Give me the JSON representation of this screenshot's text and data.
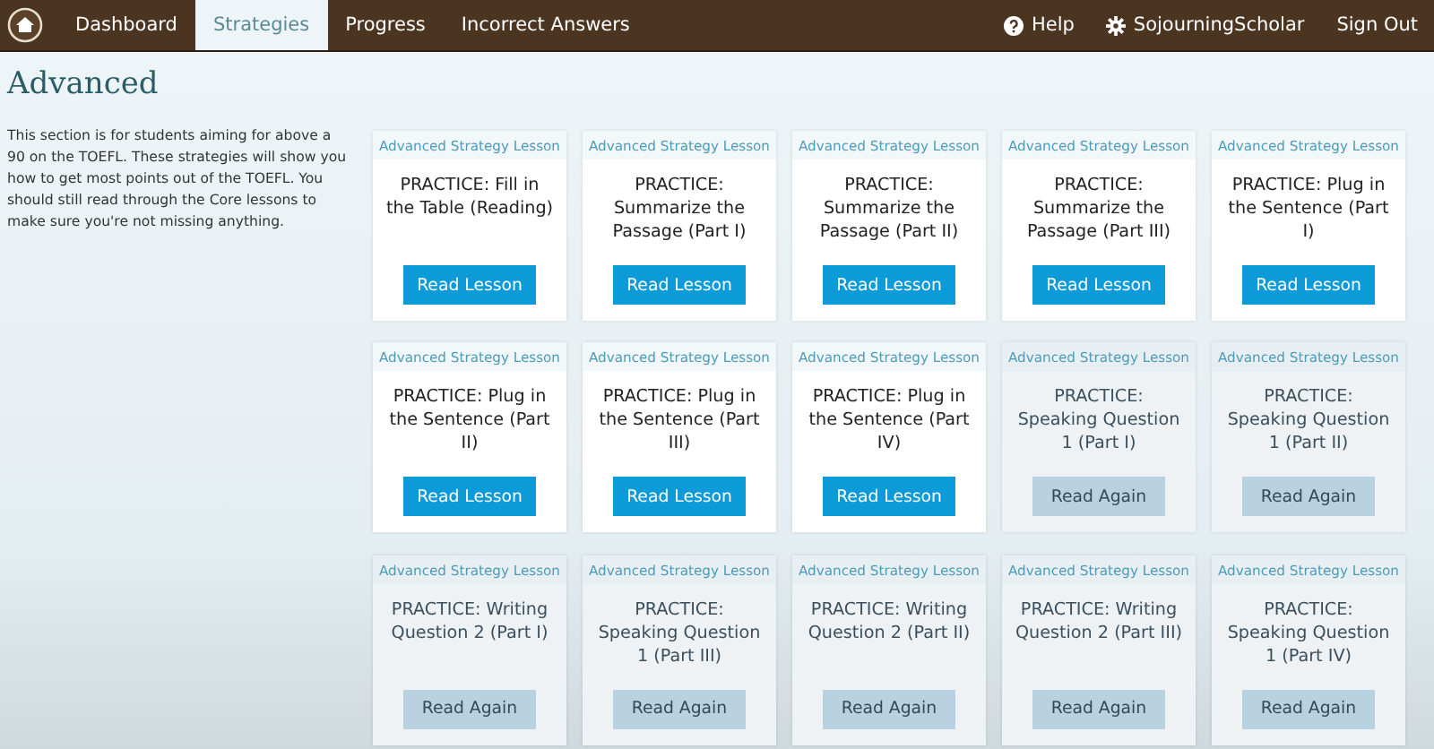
{
  "nav": {
    "tabs": [
      {
        "label": "Dashboard",
        "selected": false
      },
      {
        "label": "Strategies",
        "selected": true
      },
      {
        "label": "Progress",
        "selected": false
      },
      {
        "label": "Incorrect Answers",
        "selected": false
      }
    ],
    "right": [
      {
        "kind": "help",
        "label": "Help"
      },
      {
        "kind": "user",
        "label": "SojourningScholar"
      },
      {
        "kind": "plain",
        "label": "Sign Out"
      }
    ]
  },
  "section": {
    "title": "Advanced",
    "description": "This section is for students aiming for above a 90 on the TOEFL. These strategies will show you how to get most points out of the TOEFL. You should still read through the Core lessons to make sure you're not missing anything."
  },
  "lessons": [
    {
      "label": "Advanced Strategy Lesson",
      "title": "PRACTICE: Fill in the Table (Reading)",
      "button": "Read Lesson",
      "completed": false
    },
    {
      "label": "Advanced Strategy Lesson",
      "title": "PRACTICE: Summarize the Passage (Part I)",
      "button": "Read Lesson",
      "completed": false
    },
    {
      "label": "Advanced Strategy Lesson",
      "title": "PRACTICE: Summarize the Passage (Part II)",
      "button": "Read Lesson",
      "completed": false
    },
    {
      "label": "Advanced Strategy Lesson",
      "title": "PRACTICE: Summarize the Passage (Part III)",
      "button": "Read Lesson",
      "completed": false
    },
    {
      "label": "Advanced Strategy Lesson",
      "title": "PRACTICE: Plug in the Sentence (Part I)",
      "button": "Read Lesson",
      "completed": false
    },
    {
      "label": "Advanced Strategy Lesson",
      "title": "PRACTICE: Plug in the Sentence (Part II)",
      "button": "Read Lesson",
      "completed": false
    },
    {
      "label": "Advanced Strategy Lesson",
      "title": "PRACTICE: Plug in the Sentence (Part III)",
      "button": "Read Lesson",
      "completed": false
    },
    {
      "label": "Advanced Strategy Lesson",
      "title": "PRACTICE: Plug in the Sentence (Part IV)",
      "button": "Read Lesson",
      "completed": false
    },
    {
      "label": "Advanced Strategy Lesson",
      "title": "PRACTICE: Speaking Question 1 (Part I)",
      "button": "Read Again",
      "completed": true
    },
    {
      "label": "Advanced Strategy Lesson",
      "title": "PRACTICE: Speaking Question 1 (Part II)",
      "button": "Read Again",
      "completed": true
    },
    {
      "label": "Advanced Strategy Lesson",
      "title": "PRACTICE: Writing Question 2 (Part I)",
      "button": "Read Again",
      "completed": true
    },
    {
      "label": "Advanced Strategy Lesson",
      "title": "PRACTICE: Speaking Question 1 (Part III)",
      "button": "Read Again",
      "completed": true
    },
    {
      "label": "Advanced Strategy Lesson",
      "title": "PRACTICE: Writing Question 2 (Part II)",
      "button": "Read Again",
      "completed": true
    },
    {
      "label": "Advanced Strategy Lesson",
      "title": "PRACTICE: Writing Question 2 (Part III)",
      "button": "Read Again",
      "completed": true
    },
    {
      "label": "Advanced Strategy Lesson",
      "title": "PRACTICE: Speaking Question 1 (Part IV)",
      "button": "Read Again",
      "completed": true
    }
  ]
}
